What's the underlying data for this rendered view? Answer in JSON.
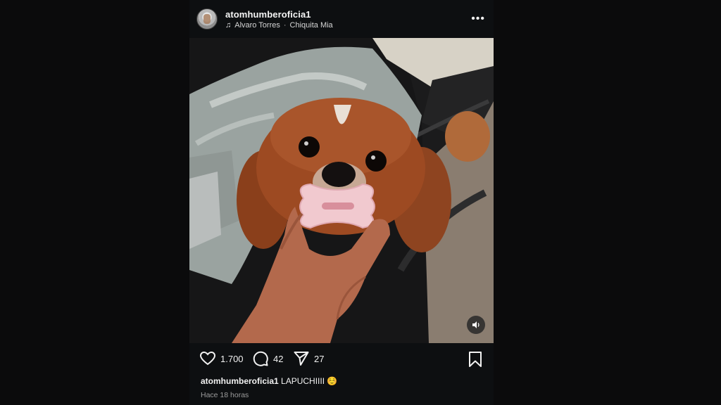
{
  "post": {
    "username": "atomhumberoficia1",
    "music": {
      "artist": "Alvaro Torres",
      "separator": "·",
      "song": "Chiquita Mia",
      "icon": "music-note-icon"
    },
    "more_icon": "more-options-icon",
    "photo": {
      "description_icon": "volume-icon"
    },
    "actions": {
      "likes": "1.700",
      "comments": "42",
      "shares": "27"
    },
    "caption": {
      "username": "atomhumberoficia1",
      "text": "LAPUCHIIII ☺️"
    },
    "timestamp": "Hace 18 horas"
  },
  "colors": {
    "background": "#0b0b0c",
    "post_background": "#0d0f11",
    "text": "#f2f2f2",
    "muted": "#9c9c9c"
  }
}
